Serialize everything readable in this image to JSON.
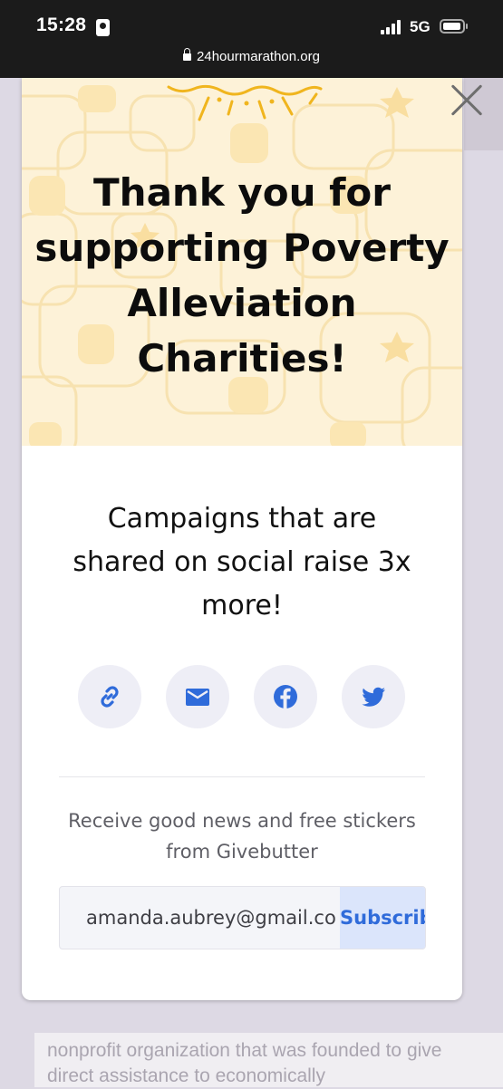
{
  "status_bar": {
    "time": "15:28",
    "network": "5G"
  },
  "browser": {
    "url": "24hourmarathon.org"
  },
  "modal": {
    "title": "Thank you for supporting Poverty Alleviation Charities!",
    "message": "Campaigns that are shared on social raise 3x more!",
    "share_buttons": [
      {
        "icon": "link-icon",
        "color": "#2f6bda"
      },
      {
        "icon": "email-icon",
        "color": "#2f6bda"
      },
      {
        "icon": "facebook-icon",
        "color": "#2f6bda"
      },
      {
        "icon": "twitter-icon",
        "color": "#2f6bda"
      }
    ],
    "newsletter": {
      "text": "Receive good news and free stickers from Givebutter",
      "email_value": "amanda.aubrey@gmail.com",
      "subscribe_label": "Subscribe"
    }
  },
  "background_page": {
    "text": "nonprofit organization that was founded to give direct assistance to economically"
  },
  "colors": {
    "accent": "#2f6bda",
    "hero_bg": "#fdf2d8"
  }
}
